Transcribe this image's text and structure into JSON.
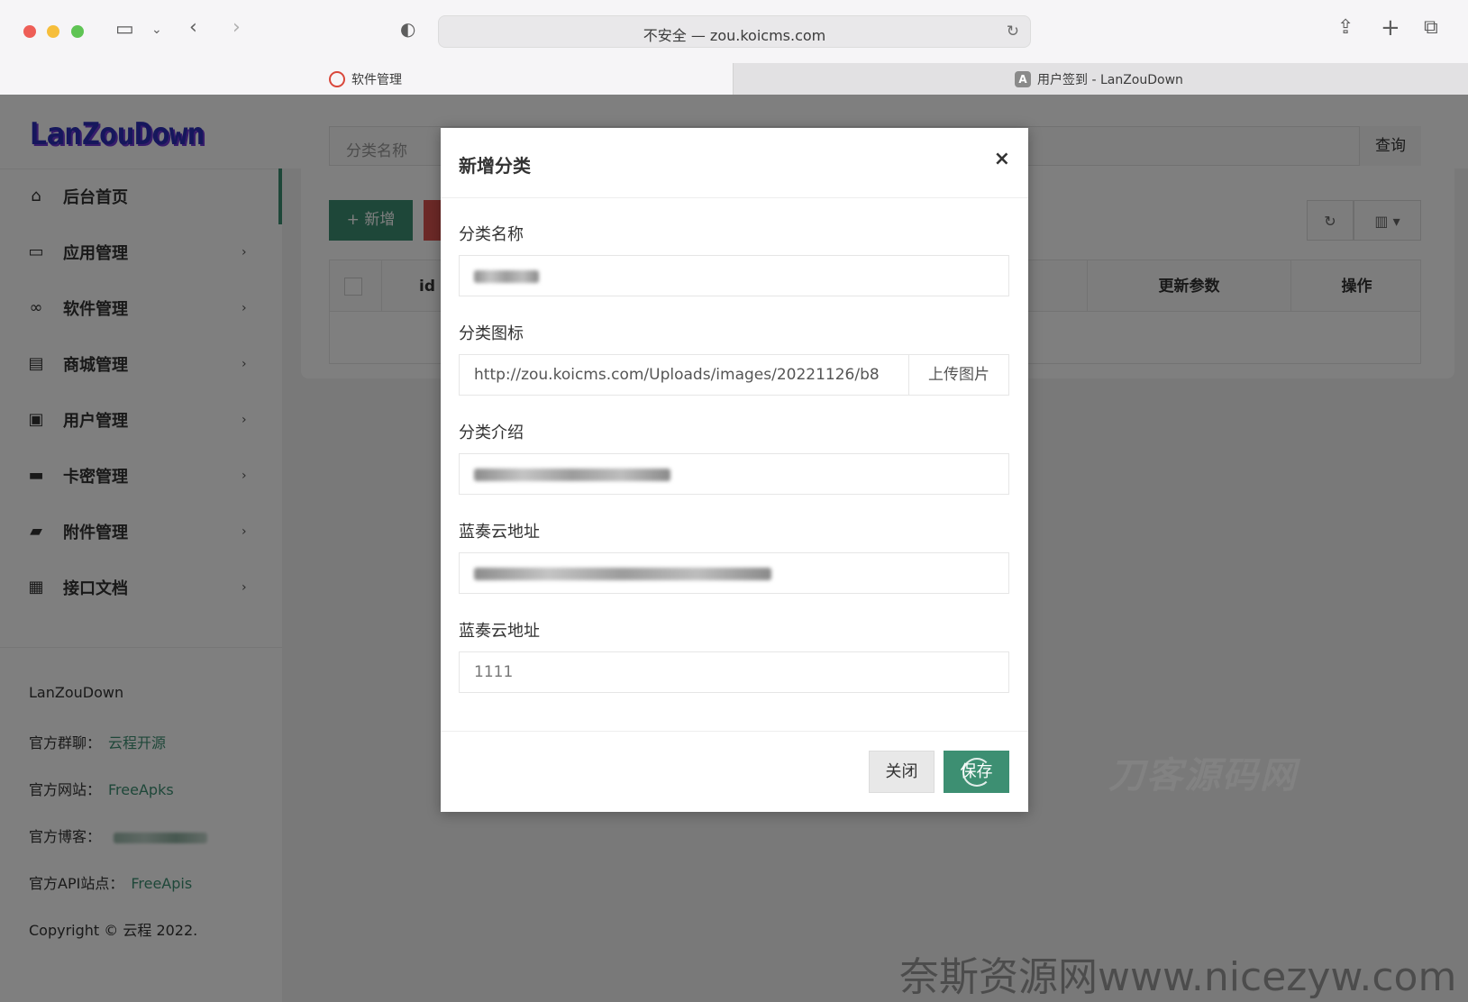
{
  "browser": {
    "url": "不安全 — zou.koicms.com",
    "tabs": [
      {
        "label": "软件管理",
        "icon": "brand-swirl-icon"
      },
      {
        "label": "用户签到 - LanZouDown",
        "icon": "letter-a-icon",
        "badge": "A"
      }
    ]
  },
  "sidebar": {
    "logo": "LanZouDown",
    "items": [
      {
        "label": "后台首页",
        "icon": "home-icon"
      },
      {
        "label": "应用管理",
        "icon": "laptop-icon"
      },
      {
        "label": "软件管理",
        "icon": "infinity-icon"
      },
      {
        "label": "商城管理",
        "icon": "store-icon"
      },
      {
        "label": "用户管理",
        "icon": "user-badge-icon"
      },
      {
        "label": "卡密管理",
        "icon": "card-icon"
      },
      {
        "label": "附件管理",
        "icon": "folder-icon"
      },
      {
        "label": "接口文档",
        "icon": "inbox-icon"
      }
    ],
    "footer": {
      "name": "LanZouDown",
      "group_label": "官方群聊：",
      "group_link": "云程开源",
      "site_label": "官方网站：",
      "site_link": "FreeApks",
      "blog_label": "官方博客：",
      "api_label": "官方API站点：",
      "api_link": "FreeApis",
      "copyright": "Copyright © 云程 2022."
    }
  },
  "page": {
    "search_placeholder": "分类名称",
    "query_button": "查询",
    "add_button": "+ 新增",
    "columns": [
      "id",
      "更新参数",
      "操作"
    ]
  },
  "modal": {
    "title": "新增分类",
    "close_icon": "×",
    "fields": {
      "name_label": "分类名称",
      "icon_label": "分类图标",
      "icon_value": "http://zou.koicms.com/Uploads/images/20221126/b8",
      "upload_button": "上传图片",
      "intro_label": "分类介绍",
      "lanzou_label_1": "蓝奏云地址",
      "lanzou_label_2": "蓝奏云地址",
      "lanzou_value_2": "1111"
    },
    "close_button": "关闭",
    "save_button": "保存"
  },
  "watermarks": {
    "center": "刀客源码网",
    "bottom": "奈斯资源网www.nicezyw.com"
  },
  "colors": {
    "accent": "#3d8f72",
    "danger": "#d9534f",
    "logo": "#2c2fb8"
  }
}
